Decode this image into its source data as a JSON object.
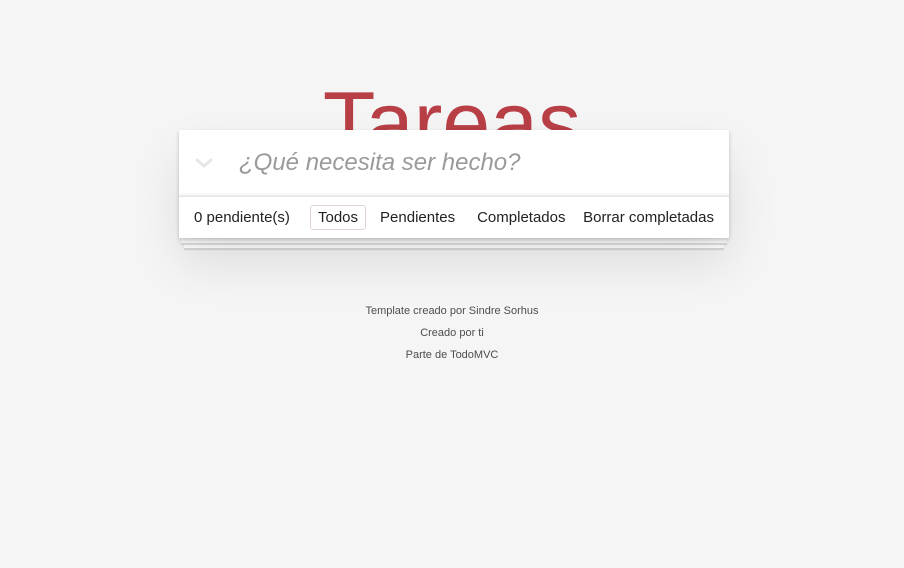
{
  "header": {
    "title": "Tareas"
  },
  "new_todo": {
    "placeholder": "¿Qué necesita ser hecho?",
    "value": ""
  },
  "toggle_all": {
    "icon": "chevron-down-icon"
  },
  "footer": {
    "count_label": "0 pendiente(s)",
    "filters": [
      {
        "label": "Todos",
        "selected": true
      },
      {
        "label": "Pendientes",
        "selected": false
      },
      {
        "label": "Completados",
        "selected": false
      }
    ],
    "clear_label": "Borrar completadas"
  },
  "info": {
    "line1": "Template creado por Sindre Sorhus",
    "line2": "Creado por ti",
    "line3": "Parte de TodoMVC"
  },
  "colors": {
    "accent": "#b83f45",
    "background": "#f5f5f5",
    "card": "#ffffff",
    "selected_border": "#e1d3d3"
  }
}
